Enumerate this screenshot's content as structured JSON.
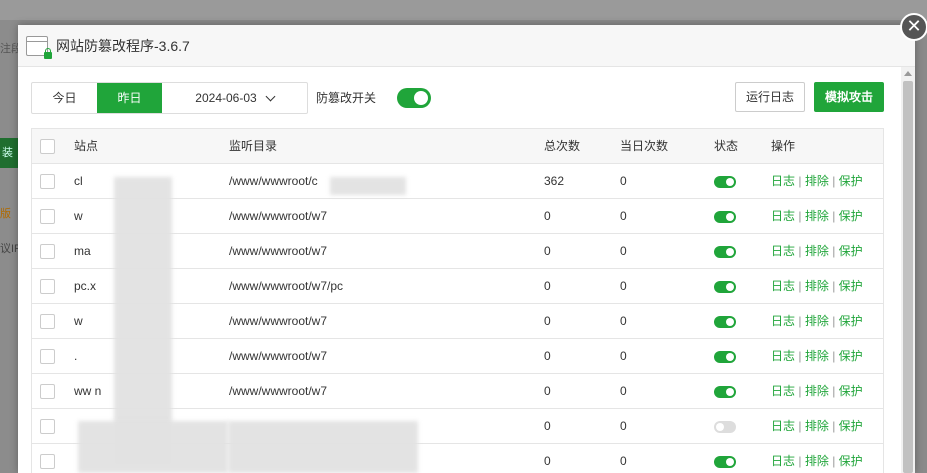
{
  "background": {
    "left_text_top": "注段",
    "green_tab": "装",
    "orange_text": "版",
    "ip_text": "议IP"
  },
  "dialog": {
    "title": "网站防篡改程序-3.6.7",
    "close_icon": "close-icon"
  },
  "toolbar": {
    "today": "今日",
    "yesterday": "昨日",
    "date": "2024-06-03",
    "tamper_switch_label": "防篡改开关",
    "tamper_switch_on": true,
    "run_log": "运行日志",
    "simulate_attack": "模拟攻击"
  },
  "table": {
    "headers": {
      "site": "站点",
      "dir": "监听目录",
      "total": "总次数",
      "today": "当日次数",
      "status": "状态",
      "ops": "操作"
    },
    "ops": {
      "log": "日志",
      "exclude": "排除",
      "protect": "保护",
      "sep": "|"
    },
    "rows": [
      {
        "site": "cl",
        "dir": "/www/wwwroot/c",
        "total": "362",
        "today": "0",
        "on": true
      },
      {
        "site": "w",
        "dir": "/www/wwwroot/w7",
        "total": "0",
        "today": "0",
        "on": true
      },
      {
        "site": "ma",
        "dir": "/www/wwwroot/w7",
        "total": "0",
        "today": "0",
        "on": true
      },
      {
        "site": "pc.x",
        "dir": "/www/wwwroot/w7/pc",
        "total": "0",
        "today": "0",
        "on": true
      },
      {
        "site": "w",
        "dir": "/www/wwwroot/w7",
        "total": "0",
        "today": "0",
        "on": true
      },
      {
        "site": ".",
        "dir": "/www/wwwroot/w7",
        "total": "0",
        "today": "0",
        "on": true
      },
      {
        "site": "ww                n",
        "dir": "/www/wwwroot/w7",
        "total": "0",
        "today": "0",
        "on": true
      },
      {
        "site": "",
        "dir": "",
        "total": "0",
        "today": "0",
        "on": false
      },
      {
        "site": "",
        "dir": "",
        "total": "0",
        "today": "0",
        "on": true
      }
    ]
  }
}
